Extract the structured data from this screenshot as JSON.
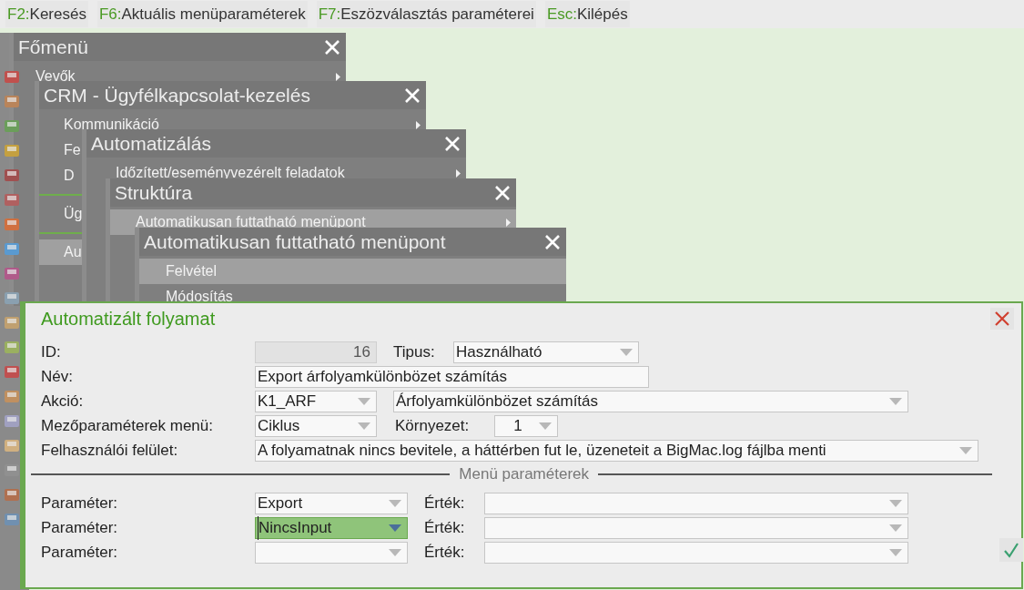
{
  "shortcut_bar": [
    {
      "key": "F2:",
      "label": "Keresés"
    },
    {
      "key": "F6:",
      "label": "Aktuális menüparaméterek"
    },
    {
      "key": "F7:",
      "label": "Eszözválasztás paraméterei"
    },
    {
      "key": "Esc:",
      "label": "Kilépés"
    }
  ],
  "menus": [
    {
      "title": "Főmenü",
      "items": [
        {
          "kind": "item",
          "label": "Vevők",
          "submenu": true,
          "selected": false
        }
      ]
    },
    {
      "title": "CRM - Ügyfélkapcsolat-kezelés",
      "items": [
        {
          "kind": "item",
          "label": "Kommunikáció",
          "submenu": true,
          "selected": false
        },
        {
          "kind": "item",
          "label": "Fe",
          "submenu": false,
          "selected": false
        },
        {
          "kind": "item",
          "label": "D",
          "submenu": false,
          "selected": false
        },
        {
          "kind": "separator"
        },
        {
          "kind": "item",
          "label": "Üg",
          "submenu": false,
          "selected": false
        },
        {
          "kind": "separator"
        },
        {
          "kind": "item",
          "label": "Au",
          "submenu": false,
          "selected": true
        }
      ]
    },
    {
      "title": "Automatizálás",
      "items": [
        {
          "kind": "item",
          "label": "Időzített/eseményvezérelt feladatok",
          "submenu": true,
          "selected": false
        }
      ]
    },
    {
      "title": "Struktúra",
      "items": [
        {
          "kind": "item",
          "label": "Automatikusan futtatható menüpont",
          "submenu": true,
          "selected": true
        }
      ]
    },
    {
      "title": "Automatikusan futtatható menüpont",
      "items": [
        {
          "kind": "item",
          "label": "Felvétel",
          "submenu": false,
          "selected": true
        },
        {
          "kind": "item",
          "label": "Módosítás",
          "submenu": false,
          "selected": false
        }
      ]
    }
  ],
  "dialog": {
    "title": "Automatizált folyamat",
    "id": {
      "label": "ID:",
      "value": "16",
      "disabled": true
    },
    "type": {
      "label": "Tipus:",
      "value": "Használható"
    },
    "name": {
      "label": "Név:",
      "value": "Export árfolyamkülönbözet számítás"
    },
    "action": {
      "label": "Akció:",
      "code": "K1_ARF",
      "description": "Árfolyamkülönbözet számítás"
    },
    "field_params_menu": {
      "label": "Mezőparaméterek menü:",
      "value": "Ciklus"
    },
    "environment": {
      "label": "Környezet:",
      "value": "1"
    },
    "user_interface": {
      "label": "Felhasználói felület:",
      "value": "A folyamatnak nincs bevitele, a háttérben fut le, üzeneteit a BigMac.log fájlba menti"
    },
    "section_title": "Menü paraméterek",
    "parameters": [
      {
        "label": "Paraméter:",
        "value": "Export",
        "value_label": "Érték:",
        "focused": false
      },
      {
        "label": "Paraméter:",
        "value": "NincsInput",
        "value_label": "Érték:",
        "focused": true
      },
      {
        "label": "Paraméter:",
        "value_label": "Érték:",
        "focused": false
      }
    ]
  }
}
